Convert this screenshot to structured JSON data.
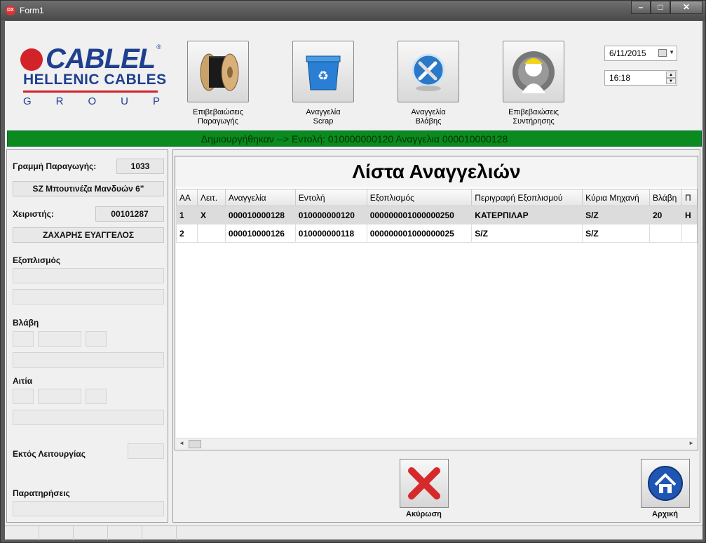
{
  "window": {
    "title": "Form1",
    "icon_text": "DX"
  },
  "logo": {
    "brand": "CABLEL",
    "registered": "®",
    "line2": "HELLENIC CABLES",
    "group_letters": [
      "G",
      "R",
      "O",
      "U",
      "P"
    ]
  },
  "toolbar": [
    {
      "label": "Επιβεβαιώσεις\nΠαραγωγής",
      "icon": "cable-reel-icon"
    },
    {
      "label": "Αναγγελία\nScrap",
      "icon": "recycle-bin-icon"
    },
    {
      "label": "Αναγγελία\nΒλάβης",
      "icon": "tools-icon"
    },
    {
      "label": "Επιβεβαιώσεις\nΣυντήρησης",
      "icon": "maintenance-worker-icon"
    }
  ],
  "date": "6/11/2015",
  "time": "16:18",
  "status_message": "Δημιουργήθηκαν --> Εντολή: 010000000120 Αναγγελια 000010000128",
  "left": {
    "line_label": "Γραμμή Παραγωγής:",
    "line_value": "1033",
    "product": "SZ Μπουτινέζα Μανδυών 6\"",
    "operator_label": "Χειριστής:",
    "operator_value": "00101287",
    "operator_name": "ΖΑΧΑΡΗΣ ΕΥΑΓΓΕΛΟΣ",
    "equipment_label": "Εξοπλισμός",
    "fault_label": "Βλάβη",
    "cause_label": "Αιτία",
    "out_of_service_label": "Εκτός Λειτουργίας",
    "notes_label": "Παρατηρήσεις"
  },
  "grid": {
    "title": "Λίστα Αναγγελιών",
    "columns": [
      "ΑΑ",
      "Λειτ.",
      "Αναγγελία",
      "Εντολή",
      "Εξοπλισμός",
      "Περιγραφή Εξοπλισμού",
      "Κύρια Μηχανή",
      "Βλάβη",
      "Π"
    ],
    "rows": [
      [
        "1",
        "X",
        "000010000128",
        "010000000120",
        "000000001000000250",
        "ΚΑΤΕΡΠΙΛΑΡ",
        "S/Z",
        "20",
        "Η"
      ],
      [
        "2",
        "",
        "000010000126",
        "010000000118",
        "000000001000000025",
        "S/Z",
        "S/Z",
        "",
        ""
      ]
    ]
  },
  "buttons": {
    "cancel": "Ακύρωση",
    "home": "Αρχική"
  },
  "colors": {
    "status_green": "#0a8a1f",
    "logo_blue": "#1f3f8f",
    "logo_red": "#d2232a"
  }
}
